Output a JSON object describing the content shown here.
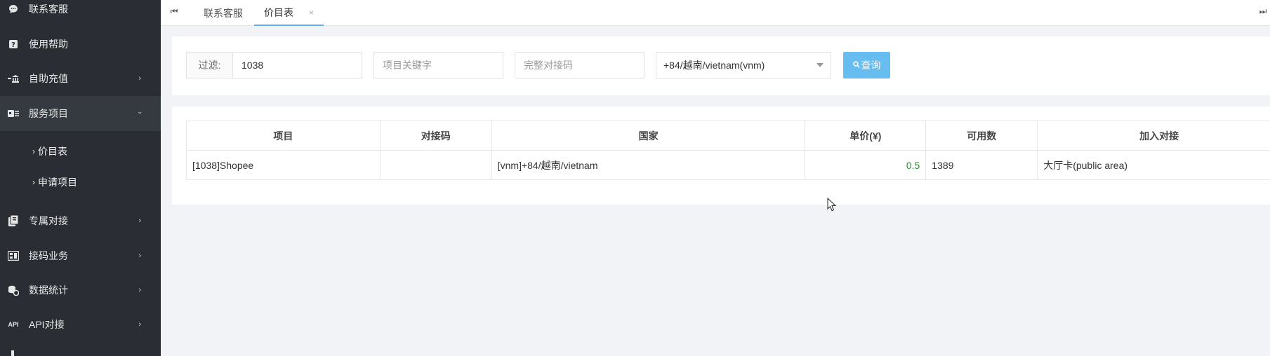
{
  "sidebar": {
    "items": [
      {
        "label": "联系客服",
        "icon": "chat-icon"
      },
      {
        "label": "使用帮助",
        "icon": "help-icon"
      },
      {
        "label": "自助充值",
        "icon": "recharge-icon"
      },
      {
        "label": "服务项目",
        "icon": "service-icon"
      },
      {
        "label": "专属对接",
        "icon": "exclusive-icon"
      },
      {
        "label": "接码业务",
        "icon": "sms-business-icon"
      },
      {
        "label": "数据统计",
        "icon": "stats-icon"
      },
      {
        "label": "API对接",
        "icon": "api-icon"
      }
    ],
    "sub_items": [
      {
        "label": "价目表"
      },
      {
        "label": "申请项目"
      }
    ],
    "api_icon_text": "API"
  },
  "tabs": [
    {
      "label": "联系客服"
    },
    {
      "label": "价目表",
      "close": "×"
    }
  ],
  "filter": {
    "prefix_label": "过滤:",
    "filter_value": "1038",
    "keyword_placeholder": "项目关键字",
    "code_placeholder": "完整对接码",
    "country_selected": "+84/越南/vietnam(vnm)",
    "search_label": "查询"
  },
  "table": {
    "headers": [
      "项目",
      "对接码",
      "国家",
      "单价(¥)",
      "可用数",
      "加入对接"
    ],
    "rows": [
      [
        "[1038]Shopee",
        "",
        "[vnm]+84/越南/vietnam",
        "0.5",
        "1389",
        "大厅卡(public area)"
      ]
    ]
  },
  "colors": {
    "sidebar_bg": "#2a2d33",
    "accent": "#5fb0e8",
    "search_button": "#67bdf0",
    "price_green": "#2e8b2e"
  }
}
